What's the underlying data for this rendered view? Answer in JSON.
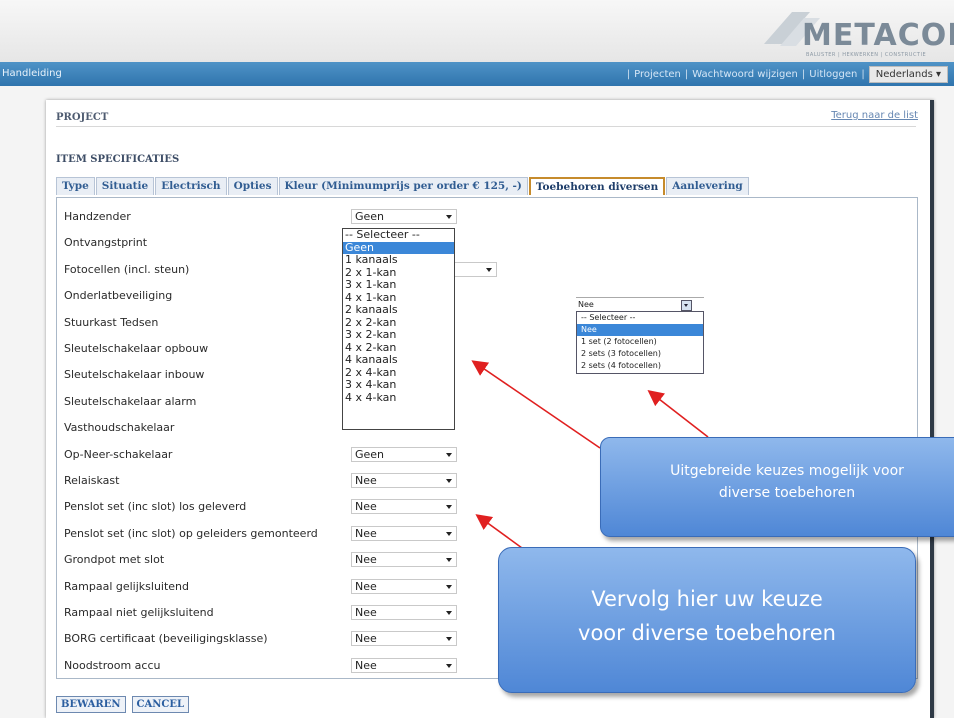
{
  "brand": {
    "logo_text": "METACON",
    "logo_sub": "BALUSTER | HEKWERKEN | CONSTRUCTIE"
  },
  "nav": {
    "left_link": "Handleiding",
    "links": [
      "Projecten",
      "Wachtwoord wijzigen",
      "Uitloggen"
    ],
    "separator": "|",
    "language": "Nederlands"
  },
  "page": {
    "section_label": "PROJECT",
    "back_link": "Terug naar de list",
    "spec_title": "ITEM SPECIFICATIES"
  },
  "tabs": [
    {
      "label": "Type"
    },
    {
      "label": "Situatie"
    },
    {
      "label": "Electrisch"
    },
    {
      "label": "Opties"
    },
    {
      "label": "Kleur (Minimumprijs per order € 125, -)"
    },
    {
      "label": "Toebehoren diversen",
      "active": true
    },
    {
      "label": "Aanlevering"
    }
  ],
  "form": {
    "rows": [
      {
        "label": "Handzender",
        "value": "Geen"
      },
      {
        "label": "Ontvangstprint",
        "value": ""
      },
      {
        "label": "Fotocellen (incl. steun)",
        "value": ""
      },
      {
        "label": "Onderlatbeveiliging",
        "value": ""
      },
      {
        "label": "Stuurkast Tedsen",
        "value": ""
      },
      {
        "label": "Sleutelschakelaar opbouw",
        "value": ""
      },
      {
        "label": "Sleutelschakelaar inbouw",
        "value": ""
      },
      {
        "label": "Sleutelschakelaar alarm",
        "value": ""
      },
      {
        "label": "Vasthoudschakelaar",
        "value": ""
      },
      {
        "label": "Op-Neer-schakelaar",
        "value": "Geen"
      },
      {
        "label": "Relaiskast",
        "value": "Nee"
      },
      {
        "label": "Penslot set (inc slot) los geleverd",
        "value": "Nee"
      },
      {
        "label": "Penslot set (inc slot) op geleiders gemonteerd",
        "value": "Nee"
      },
      {
        "label": "Grondpot met slot",
        "value": "Nee"
      },
      {
        "label": "Rampaal gelijksluitend",
        "value": "Nee"
      },
      {
        "label": "Rampaal niet gelijksluitend",
        "value": "Nee"
      },
      {
        "label": "BORG certificaat (beveiligingsklasse)",
        "value": "Nee"
      },
      {
        "label": "Noodstroom accu",
        "value": "Nee"
      }
    ],
    "open_dropdown_options": [
      "-- Selecteer --",
      "Geen",
      "1 kanaals",
      "2 x 1-kan",
      "3 x 1-kan",
      "4 x 1-kan",
      "2 kanaals",
      "2 x 2-kan",
      "3 x 2-kan",
      "4 x 2-kan",
      "4 kanaals",
      "2 x 4-kan",
      "3 x 4-kan",
      "4 x 4-kan"
    ],
    "open_dropdown_selected": "Geen",
    "mini_dropdown": {
      "value": "Nee",
      "options": [
        "-- Selecteer --",
        "Nee",
        "1 set (2 fotocellen)",
        "2 sets (3 fotocellen)",
        "2 sets (4 fotocellen)"
      ],
      "selected": "Nee"
    }
  },
  "callouts": {
    "small": [
      "Uitgebreide keuzes mogelijk voor",
      "diverse toebehoren"
    ],
    "large": [
      "Vervolg hier uw keuze",
      "voor diverse toebehoren"
    ]
  },
  "buttons": {
    "save": "BEWAREN",
    "cancel": "CANCEL"
  },
  "colors": {
    "navbar": "#3b82bd",
    "callout": "#6b9fe0",
    "arrow": "#e02020",
    "active_tab_border": "#c68b2c"
  }
}
